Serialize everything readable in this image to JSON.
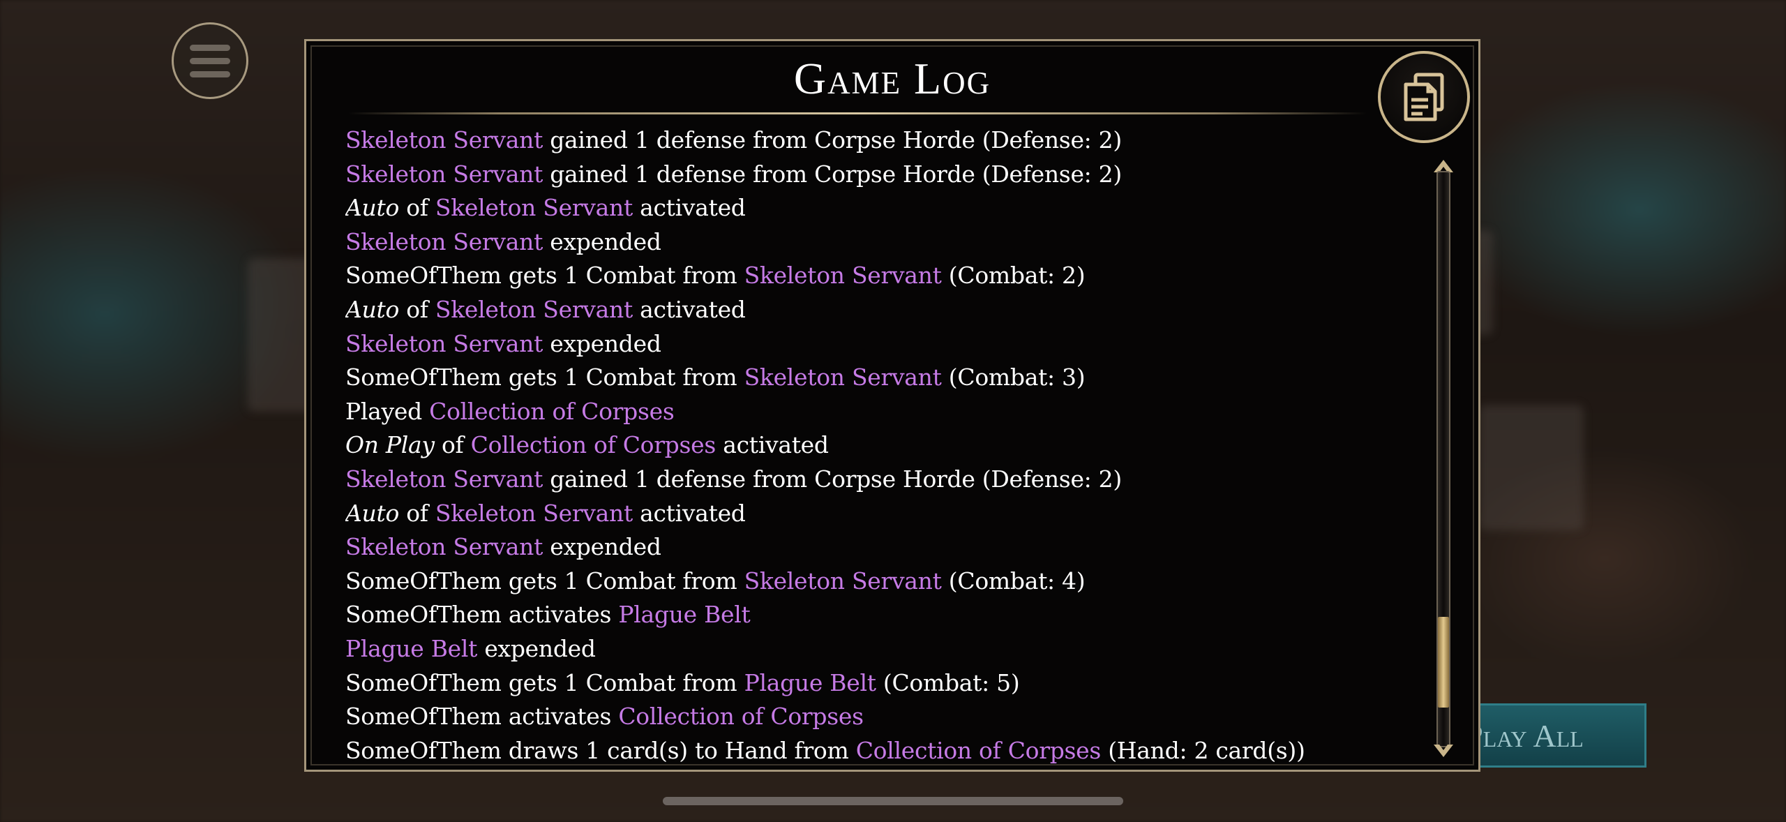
{
  "title": "Game Log",
  "play_all_label": "Play All",
  "colors": {
    "card_name": "#c67be6",
    "text": "#ffffff",
    "panel_border": "#a4957a"
  },
  "icons": {
    "menu": "hamburger-menu-icon",
    "copy": "copy-documents-icon"
  },
  "scroll_position": 0.92,
  "log_entries": [
    [
      {
        "t": "Skeleton Servant",
        "c": 1
      },
      {
        "t": " gained 1 defense from Corpse Horde (Defense: 2)"
      }
    ],
    [
      {
        "t": "Skeleton Servant",
        "c": 1
      },
      {
        "t": " gained 1 defense from Corpse Horde (Defense: 2)"
      }
    ],
    [
      {
        "t": "Auto",
        "i": 1
      },
      {
        "t": " of "
      },
      {
        "t": "Skeleton Servant",
        "c": 1
      },
      {
        "t": " activated"
      }
    ],
    [
      {
        "t": "Skeleton Servant",
        "c": 1
      },
      {
        "t": " expended"
      }
    ],
    [
      {
        "t": "SomeOfThem gets 1 Combat from "
      },
      {
        "t": "Skeleton Servant",
        "c": 1
      },
      {
        "t": " (Combat: 2)"
      }
    ],
    [
      {
        "t": "Auto",
        "i": 1
      },
      {
        "t": " of "
      },
      {
        "t": "Skeleton Servant",
        "c": 1
      },
      {
        "t": " activated"
      }
    ],
    [
      {
        "t": "Skeleton Servant",
        "c": 1
      },
      {
        "t": " expended"
      }
    ],
    [
      {
        "t": "SomeOfThem gets 1 Combat from "
      },
      {
        "t": "Skeleton Servant",
        "c": 1
      },
      {
        "t": " (Combat: 3)"
      }
    ],
    [
      {
        "t": "Played "
      },
      {
        "t": "Collection of Corpses",
        "c": 1
      }
    ],
    [
      {
        "t": "On Play",
        "i": 1
      },
      {
        "t": " of "
      },
      {
        "t": "Collection of Corpses",
        "c": 1
      },
      {
        "t": " activated"
      }
    ],
    [
      {
        "t": "Skeleton Servant",
        "c": 1
      },
      {
        "t": " gained 1 defense from Corpse Horde (Defense: 2)"
      }
    ],
    [
      {
        "t": "Auto",
        "i": 1
      },
      {
        "t": " of "
      },
      {
        "t": "Skeleton Servant",
        "c": 1
      },
      {
        "t": " activated"
      }
    ],
    [
      {
        "t": "Skeleton Servant",
        "c": 1
      },
      {
        "t": " expended"
      }
    ],
    [
      {
        "t": "SomeOfThem gets 1 Combat from "
      },
      {
        "t": "Skeleton Servant",
        "c": 1
      },
      {
        "t": " (Combat: 4)"
      }
    ],
    [
      {
        "t": "SomeOfThem activates "
      },
      {
        "t": "Plague Belt",
        "c": 1
      }
    ],
    [
      {
        "t": "Plague Belt",
        "c": 1
      },
      {
        "t": " expended"
      }
    ],
    [
      {
        "t": "SomeOfThem gets 1 Combat from "
      },
      {
        "t": "Plague Belt",
        "c": 1
      },
      {
        "t": " (Combat: 5)"
      }
    ],
    [
      {
        "t": "SomeOfThem activates "
      },
      {
        "t": "Collection of Corpses",
        "c": 1
      }
    ],
    [
      {
        "t": "SomeOfThem draws 1 card(s) to Hand from "
      },
      {
        "t": "Collection of Corpses",
        "c": 1
      },
      {
        "t": " (Hand: 2 card(s))"
      }
    ]
  ]
}
